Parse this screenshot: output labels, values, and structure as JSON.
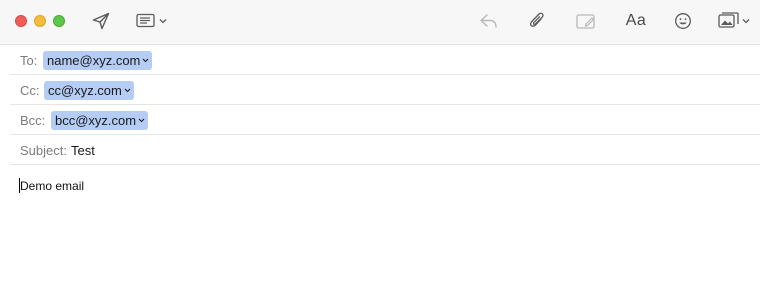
{
  "toolbar": {
    "icons": [
      "send-icon",
      "header-fields-icon",
      "reply-icon",
      "attachment-icon",
      "markup-icon",
      "format-icon",
      "emoji-icon",
      "photo-browser-icon"
    ],
    "format_label": "Aa"
  },
  "header": {
    "to_label": "To:",
    "to_value": "name@xyz.com",
    "cc_label": "Cc:",
    "cc_value": "cc@xyz.com",
    "bcc_label": "Bcc:",
    "bcc_value": "bcc@xyz.com",
    "subject_label": "Subject:",
    "subject_value": "Test"
  },
  "body": {
    "text": "Demo email"
  },
  "colors": {
    "close": "#ee5d57",
    "minimize": "#f4bc3b",
    "zoom": "#5ec649",
    "token": "#b5cdf5"
  }
}
